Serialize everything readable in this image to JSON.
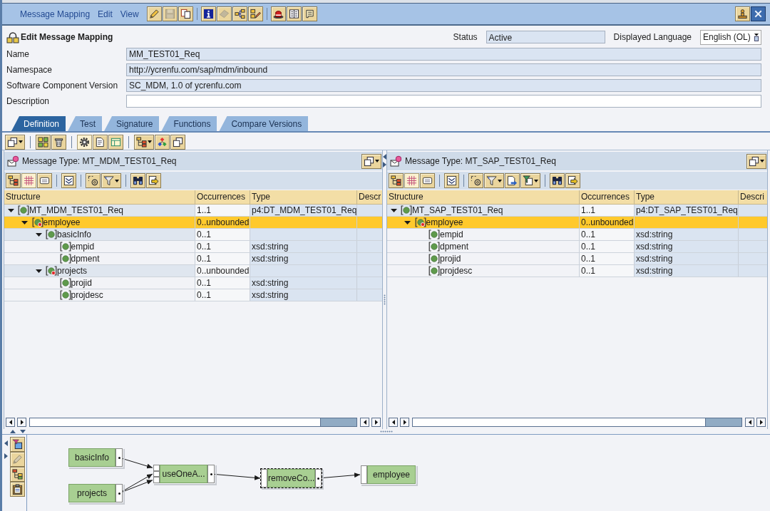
{
  "menubar": {
    "menus": [
      {
        "label": "Message Mapping"
      },
      {
        "label": "Edit"
      },
      {
        "label": "View"
      }
    ],
    "tools": [
      [
        {
          "disabled": false
        },
        {
          "disabled": true
        },
        {
          "disabled": false
        }
      ],
      [
        {
          "disabled": false
        },
        {
          "disabled": true
        },
        {
          "disabled": false
        },
        {
          "disabled": false
        }
      ],
      [
        {
          "disabled": false
        },
        {
          "disabled": false
        },
        {
          "disabled": false
        }
      ]
    ]
  },
  "header": {
    "title": "Edit Message Mapping",
    "status_label": "Status",
    "status": "Active",
    "language_label": "Displayed Language",
    "language": "English (OL)"
  },
  "fields": [
    {
      "label": "Name",
      "value": "MM_TEST01_Req",
      "readonly": true
    },
    {
      "label": "Namespace",
      "value": "http://ycrenfu.com/sap/mdm/inbound",
      "readonly": true
    },
    {
      "label": "Software Component Version",
      "value": "SC_MDM, 1.0 of ycrenfu.com",
      "readonly": true
    },
    {
      "label": "Description",
      "readonly": false
    }
  ],
  "tabs": [
    {
      "label": "Definition",
      "selected": true
    },
    {
      "label": "Test",
      "selected": false
    },
    {
      "label": "Signature",
      "selected": false
    },
    {
      "label": "Functions",
      "selected": false
    },
    {
      "label": "Compare Versions",
      "selected": false
    }
  ],
  "toolbar": [
    [
      {
        "pressed": false
      }
    ],
    [
      {
        "pressed": false
      },
      {
        "pressed": false
      }
    ],
    [
      {
        "pressed": true
      },
      {
        "pressed": false
      },
      {
        "pressed": false
      }
    ],
    [
      {
        "pressed": false
      },
      {
        "pressed": false
      },
      {
        "pressed": false
      }
    ]
  ],
  "panels": [
    {
      "title": "Message Type: MT_MDM_TEST01_Req",
      "toolbar": [
        [
          {
            "pressed": false
          },
          {
            "pressed": true
          },
          {
            "pressed": false
          }
        ],
        [
          {
            "pressed": false
          }
        ],
        [
          {
            "pressed": false
          },
          {
            "pressed": false
          }
        ],
        [
          {
            "pressed": false
          },
          {
            "pressed": false
          }
        ]
      ],
      "columns": [
        "Structure",
        "Occurrences",
        "Type",
        "Descr"
      ],
      "rows": [
        {
          "name": "MT_MDM_TEST01_Req",
          "occurrences": "1..1",
          "type": "p4:DT_MDM_TEST01_Req",
          "kind": "element",
          "expanded": true,
          "selected": false,
          "children": [
            {
              "name": "employee",
              "occurrences": "0..unbounded",
              "kind": "list",
              "expanded": true,
              "selected": true,
              "children": [
                {
                  "name": "basicInfo",
                  "occurrences": "0..1",
                  "kind": "element",
                  "expanded": true,
                  "selected": false,
                  "children": [
                    {
                      "name": "empid",
                      "occurrences": "0..1",
                      "type": "xsd:string",
                      "kind": "element",
                      "selected": false
                    },
                    {
                      "name": "dpment",
                      "occurrences": "0..1",
                      "type": "xsd:string",
                      "kind": "element",
                      "selected": false
                    }
                  ]
                },
                {
                  "name": "projects",
                  "occurrences": "0..unbounded",
                  "kind": "list",
                  "expanded": true,
                  "selected": false,
                  "children": [
                    {
                      "name": "projid",
                      "occurrences": "0..1",
                      "type": "xsd:string",
                      "kind": "element",
                      "selected": false
                    },
                    {
                      "name": "projdesc",
                      "occurrences": "0..1",
                      "type": "xsd:string",
                      "kind": "element",
                      "selected": false
                    }
                  ]
                }
              ]
            }
          ]
        }
      ]
    },
    {
      "title": "Message Type: MT_SAP_TEST01_Req",
      "toolbar": [
        [
          {
            "pressed": false
          },
          {
            "pressed": true
          },
          {
            "pressed": false
          }
        ],
        [
          {
            "pressed": false
          }
        ],
        [
          {
            "pressed": false
          },
          {
            "pressed": false
          },
          {
            "pressed": false
          },
          {
            "pressed": false
          }
        ],
        [
          {
            "pressed": false
          },
          {
            "pressed": false
          }
        ]
      ],
      "columns": [
        "Structure",
        "Occurrences",
        "Type",
        "Descri"
      ],
      "rows": [
        {
          "name": "MT_SAP_TEST01_Req",
          "occurrences": "1..1",
          "type": "p4:DT_SAP_TEST01_Req",
          "kind": "element",
          "expanded": true,
          "selected": false,
          "children": [
            {
              "name": "employee",
              "occurrences": "0..unbounded",
              "kind": "list",
              "expanded": true,
              "selected": true,
              "children": [
                {
                  "name": "empid",
                  "occurrences": "0..1",
                  "type": "xsd:string",
                  "kind": "element",
                  "selected": false
                },
                {
                  "name": "dpment",
                  "occurrences": "0..1",
                  "type": "xsd:string",
                  "kind": "element",
                  "selected": false
                },
                {
                  "name": "projid",
                  "occurrences": "0..1",
                  "type": "xsd:string",
                  "kind": "element",
                  "selected": false
                },
                {
                  "name": "projdesc",
                  "occurrences": "0..1",
                  "type": "xsd:string",
                  "kind": "element",
                  "selected": false
                }
              ]
            }
          ]
        }
      ]
    }
  ],
  "mapping": {
    "tools": [
      {
        "disabled": false
      },
      {
        "disabled": true
      },
      {
        "disabled": false
      },
      {
        "disabled": false
      }
    ],
    "nodes": [
      {
        "label": "basicInfo",
        "kind": "source",
        "selected": false
      },
      {
        "label": "projects",
        "kind": "source",
        "selected": false
      },
      {
        "label": "useOneA...",
        "kind": "multi",
        "selected": false
      },
      {
        "label": "removeCo...",
        "kind": "function",
        "selected": true
      },
      {
        "label": "employee",
        "kind": "target",
        "selected": false
      }
    ]
  }
}
